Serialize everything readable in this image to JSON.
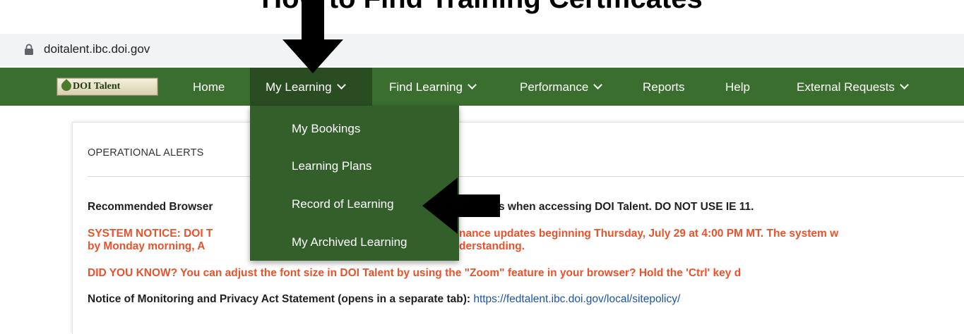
{
  "page_heading": "How to Find Training Certificates",
  "browser": {
    "url": "doitalent.ibc.doi.gov"
  },
  "nav": {
    "logo_text": "DOI Talent",
    "items": [
      {
        "label": "Home",
        "has_dropdown": false
      },
      {
        "label": "My Learning",
        "has_dropdown": true,
        "active": true
      },
      {
        "label": "Find Learning",
        "has_dropdown": true
      },
      {
        "label": "Performance",
        "has_dropdown": true
      },
      {
        "label": "Reports",
        "has_dropdown": false
      },
      {
        "label": "Help",
        "has_dropdown": false
      },
      {
        "label": "External Requests",
        "has_dropdown": true
      }
    ]
  },
  "dropdown": {
    "items": [
      {
        "label": "My Bookings"
      },
      {
        "label": "Learning Plans"
      },
      {
        "label": "Record of Learning"
      },
      {
        "label": "My Archived Learning"
      }
    ]
  },
  "alerts": {
    "title": "OPERATIONAL ALERTS",
    "recommended_prefix": "Recommended Browser",
    "recommended_suffix": "s when accessing DOI Talent. DO NOT USE IE 11.",
    "system_notice_1a": "SYSTEM NOTICE:  DOI T",
    "system_notice_1b": "nance updates beginning Thursday, July 29 at 4:00 PM MT.  The system w",
    "system_notice_2a": "by Monday morning, A",
    "system_notice_2b": "derstanding.",
    "did_you_know": "DID YOU KNOW? You can adjust the font size in DOI Talent by using the \"Zoom\" feature in your browser? Hold the 'Ctrl' key d",
    "notice_label": "Notice of Monitoring and Privacy Act Statement (opens in a separate tab):",
    "notice_link": "https://fedtalent.ibc.doi.gov/local/sitepolicy/"
  },
  "colors": {
    "nav_bg": "#3a6e2e",
    "nav_active": "#2a4c23",
    "dropdown_bg": "#33602a",
    "notice_red": "#e8532c",
    "link_blue": "#1a55a6"
  },
  "icons": {
    "lock": "lock-icon",
    "chevron": "chevron-down-icon",
    "arrow_down": "arrow-down-icon",
    "arrow_left": "arrow-left-icon"
  }
}
